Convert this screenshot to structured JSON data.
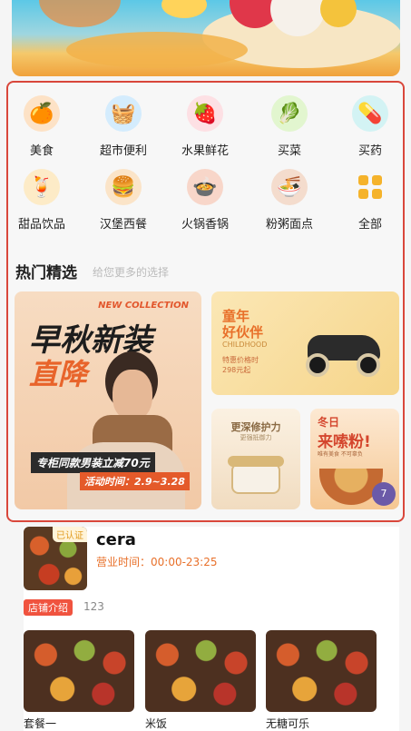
{
  "categories": [
    {
      "label": "美食",
      "icon": "food-icon",
      "glyph": "🍊",
      "color": "#f6a44c"
    },
    {
      "label": "超市便利",
      "icon": "supermarket-basket-icon",
      "glyph": "🧺",
      "color": "#5fb7f2"
    },
    {
      "label": "水果鲜花",
      "icon": "strawberry-icon",
      "glyph": "🍓",
      "color": "#f36c7c"
    },
    {
      "label": "买菜",
      "icon": "vegetable-icon",
      "glyph": "🥬",
      "color": "#8ad14d"
    },
    {
      "label": "买药",
      "icon": "medicine-box-icon",
      "glyph": "💊",
      "color": "#37c2c8"
    },
    {
      "label": "甜品饮品",
      "icon": "drink-icon",
      "glyph": "🍹",
      "color": "#f7b23a"
    },
    {
      "label": "汉堡西餐",
      "icon": "burger-icon",
      "glyph": "🍔",
      "color": "#e89a3b"
    },
    {
      "label": "火锅香锅",
      "icon": "hotpot-icon",
      "glyph": "🍲",
      "color": "#d9552e"
    },
    {
      "label": "粉粥面点",
      "icon": "noodle-bowl-icon",
      "glyph": "🍜",
      "color": "#c76b3a"
    },
    {
      "label": "全部",
      "icon": "grid-all-icon",
      "glyph": "",
      "color": "#f5b32b"
    }
  ],
  "section": {
    "title": "热门精选",
    "subtitle": "给您更多的选择"
  },
  "banners": {
    "big": {
      "tag": "NEW COLLECTION",
      "title1": "早秋新装",
      "title2": "直降",
      "promo": "专柜同款男装立减70元",
      "date": "活动时间：2.9~3.28"
    },
    "kids": {
      "title1": "童年",
      "title2": "好伙伴",
      "en": "CHILDHOOD",
      "price1": "特惠价格时",
      "price2": "298元起"
    },
    "skin": {
      "title": "更深修护力",
      "sub": "更强抵御力"
    },
    "food": {
      "title1": "冬日",
      "title2": "来嗦粉!",
      "sub": "唯有美食 不可辜负",
      "badge": "7"
    }
  },
  "shop": {
    "verified": "已认证",
    "name": "cera",
    "hours": "营业时间：00:00-23:25",
    "tag": "店铺介绍",
    "tag_value": "123",
    "dishes": [
      "套餐一",
      "米饭",
      "无糖可乐"
    ]
  }
}
